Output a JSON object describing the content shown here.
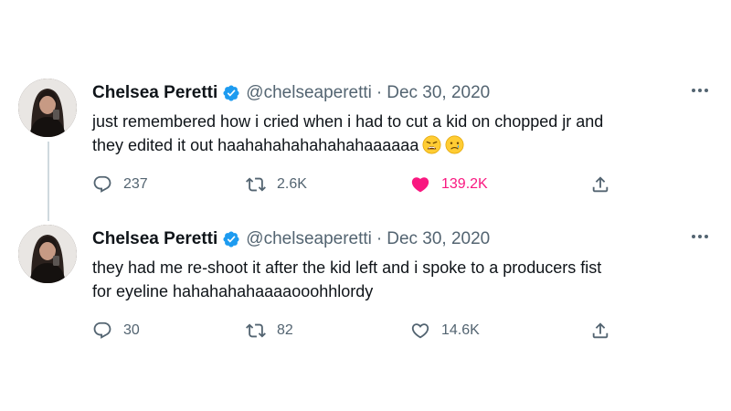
{
  "tweets": [
    {
      "author": {
        "display_name": "Chelsea Peretti",
        "handle": "@chelseaperetti",
        "verified": true
      },
      "separator": "·",
      "date": "Dec 30, 2020",
      "text_lines": [
        "just remembered how i cried when i had to cut a kid on chopped jr and",
        "they edited it out haahahahahahahahaaaaaa"
      ],
      "emojis": [
        "weary-face-emoji",
        "crying-face-emoji"
      ],
      "stats": {
        "replies": "237",
        "retweets": "2.6K",
        "likes": "139.2K",
        "liked": true
      }
    },
    {
      "author": {
        "display_name": "Chelsea Peretti",
        "handle": "@chelseaperetti",
        "verified": true
      },
      "separator": "·",
      "date": "Dec 30, 2020",
      "text_lines": [
        "they had me re-shoot it after the kid left and i spoke to a producers fist",
        "for eyeline hahahahahaaaaooohhlordy"
      ],
      "emojis": [],
      "stats": {
        "replies": "30",
        "retweets": "82",
        "likes": "14.6K",
        "liked": false
      }
    }
  ],
  "colors": {
    "text": "#0f1419",
    "secondary": "#536471",
    "verified_blue": "#1d9bf0",
    "like_pink": "#f91880",
    "thread_line": "#cfd9de"
  }
}
